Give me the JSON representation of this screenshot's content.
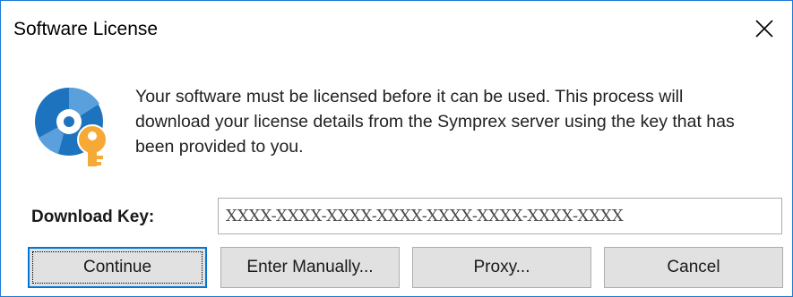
{
  "window": {
    "title": "Software License",
    "close_icon": "close-icon"
  },
  "icon": {
    "name": "disc-key-icon",
    "disc_color": "#1e73be",
    "key_color": "#f7a935"
  },
  "message": "Your software must be licensed before it can be used. This process will download your license details from the Symprex server using the key that has been provided to you.",
  "download_key": {
    "label": "Download Key:",
    "value": "XXXX-XXXX-XXXX-XXXX-XXXX-XXXX-XXXX-XXXX"
  },
  "buttons": {
    "continue": "Continue",
    "enter_manually": "Enter Manually...",
    "proxy": "Proxy...",
    "cancel": "Cancel"
  },
  "colors": {
    "accent": "#0078d7",
    "window_border": "#1b7ad6"
  }
}
